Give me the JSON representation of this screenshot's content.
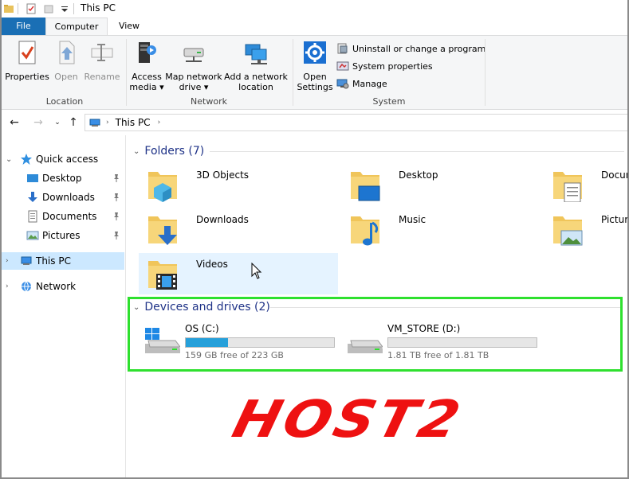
{
  "window": {
    "title": "This PC"
  },
  "ribbon": {
    "tabs": [
      {
        "label": "File"
      },
      {
        "label": "Computer"
      },
      {
        "label": "View"
      }
    ],
    "location": {
      "group_label": "Location",
      "properties": "Properties",
      "open": "Open",
      "rename": "Rename"
    },
    "network": {
      "group_label": "Network",
      "access_media_1": "Access",
      "access_media_2": "media",
      "map_drive_1": "Map network",
      "map_drive_2": "drive",
      "add_location_1": "Add a network",
      "add_location_2": "location"
    },
    "system": {
      "group_label": "System",
      "open_settings_1": "Open",
      "open_settings_2": "Settings",
      "uninstall": "Uninstall or change a program",
      "system_properties": "System properties",
      "manage": "Manage"
    }
  },
  "address": {
    "crumbs": [
      "This PC"
    ]
  },
  "nav": {
    "quick_access": "Quick access",
    "items": [
      {
        "label": "Desktop"
      },
      {
        "label": "Downloads"
      },
      {
        "label": "Documents"
      },
      {
        "label": "Pictures"
      }
    ],
    "this_pc": "This PC",
    "network": "Network"
  },
  "folders": {
    "header": "Folders (7)",
    "items": [
      {
        "label": "3D Objects"
      },
      {
        "label": "Desktop"
      },
      {
        "label": "Documents"
      },
      {
        "label": "Downloads"
      },
      {
        "label": "Music"
      },
      {
        "label": "Pictures"
      },
      {
        "label": "Videos"
      }
    ]
  },
  "drives": {
    "header": "Devices and drives (2)",
    "items": [
      {
        "label": "OS (C:)",
        "free": "159 GB free of 223 GB",
        "used_fraction": 0.287
      },
      {
        "label": "VM_STORE (D:)",
        "free": "1.81 TB free of 1.81 TB",
        "used_fraction": 0.0
      }
    ]
  },
  "logo": {
    "text": "HOST2"
  },
  "colors": {
    "accent": "#1a6fb5",
    "selection": "#cce8ff",
    "highlight_box": "#2ee02e",
    "logo": "#ee1111",
    "drive_fill": "#26a0da"
  }
}
